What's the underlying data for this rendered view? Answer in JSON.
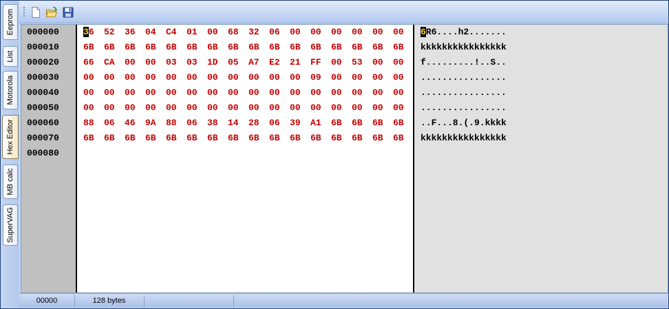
{
  "tabs": [
    {
      "label": "Eeprom",
      "active": false
    },
    {
      "label": "List",
      "active": false
    },
    {
      "label": "Motorola",
      "active": false
    },
    {
      "label": "Hex Editor",
      "active": true
    },
    {
      "label": "MB calc",
      "active": false
    },
    {
      "label": "SuperVAG",
      "active": false
    }
  ],
  "toolbar": {
    "icons": [
      "new-file-icon",
      "open-folder-icon",
      "save-disk-icon"
    ]
  },
  "hex": {
    "addresses": [
      "000000",
      "000010",
      "000020",
      "000030",
      "000040",
      "000050",
      "000060",
      "000070",
      "000080"
    ],
    "rows": [
      [
        "36",
        "52",
        "36",
        "04",
        "C4",
        "01",
        "00",
        "68",
        "32",
        "06",
        "00",
        "00",
        "00",
        "00",
        "00",
        "00"
      ],
      [
        "6B",
        "6B",
        "6B",
        "6B",
        "6B",
        "6B",
        "6B",
        "6B",
        "6B",
        "6B",
        "6B",
        "6B",
        "6B",
        "6B",
        "6B",
        "6B"
      ],
      [
        "66",
        "CA",
        "00",
        "00",
        "03",
        "03",
        "1D",
        "05",
        "A7",
        "E2",
        "21",
        "FF",
        "00",
        "53",
        "00",
        "00"
      ],
      [
        "00",
        "00",
        "00",
        "00",
        "00",
        "00",
        "00",
        "00",
        "00",
        "00",
        "00",
        "09",
        "00",
        "00",
        "00",
        "00"
      ],
      [
        "00",
        "00",
        "00",
        "00",
        "00",
        "00",
        "00",
        "00",
        "00",
        "00",
        "00",
        "00",
        "00",
        "00",
        "00",
        "00"
      ],
      [
        "00",
        "00",
        "00",
        "00",
        "00",
        "00",
        "00",
        "00",
        "00",
        "00",
        "00",
        "00",
        "00",
        "00",
        "00",
        "00"
      ],
      [
        "88",
        "06",
        "46",
        "9A",
        "88",
        "06",
        "38",
        "14",
        "28",
        "06",
        "39",
        "A1",
        "6B",
        "6B",
        "6B",
        "6B"
      ],
      [
        "6B",
        "6B",
        "6B",
        "6B",
        "6B",
        "6B",
        "6B",
        "6B",
        "6B",
        "6B",
        "6B",
        "6B",
        "6B",
        "6B",
        "6B",
        "6B"
      ]
    ],
    "ascii": [
      "6R6....h2.......",
      "kkkkkkkkkkkkkkkk",
      "f.........!..S..",
      "................",
      "................",
      "................",
      "..F...8.(.9.kkkk",
      "kkkkkkkkkkkkkkkk"
    ],
    "colors": {
      "byte": "#c00000",
      "cursor_bg": "#000000",
      "cursor_fg": "#ffd700"
    }
  },
  "status": {
    "offset": "00000",
    "size": "128 bytes"
  }
}
